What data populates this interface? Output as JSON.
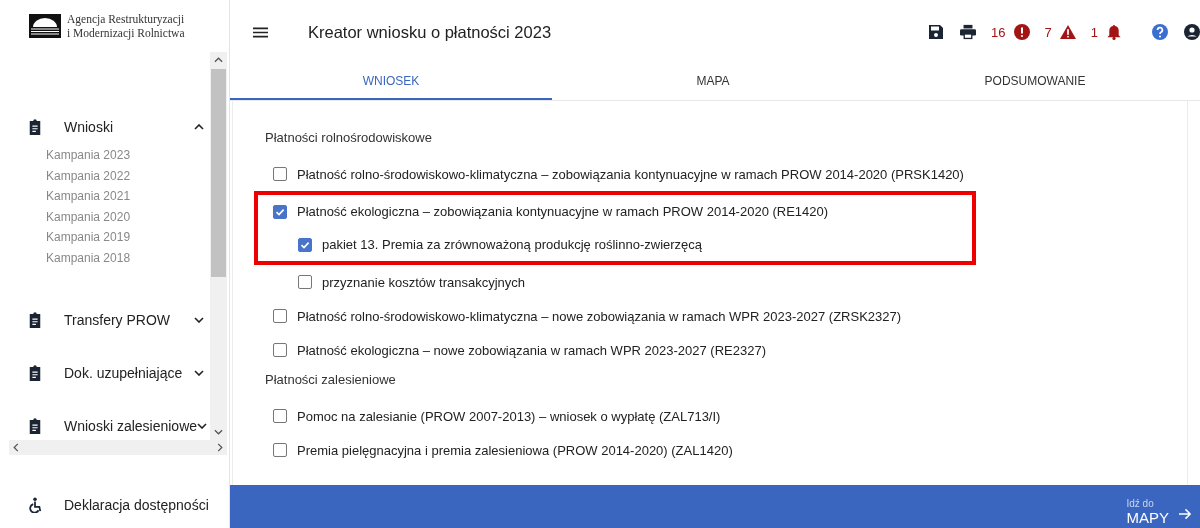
{
  "logo": {
    "line_1": "Agencja Restrukturyzacji",
    "line_2": "i Modernizacji Rolnictwa"
  },
  "sidebar": {
    "items": [
      {
        "label": "Wnioski",
        "expanded": true,
        "children": [
          {
            "label": "Kampania 2023"
          },
          {
            "label": "Kampania 2022"
          },
          {
            "label": "Kampania 2021"
          },
          {
            "label": "Kampania 2020"
          },
          {
            "label": "Kampania 2019"
          },
          {
            "label": "Kampania 2018"
          }
        ]
      },
      {
        "label": "Transfery PROW",
        "expanded": false
      },
      {
        "label": "Dok. uzupełniające",
        "expanded": false
      },
      {
        "label": "Wnioski zalesieniowe",
        "expanded": false
      }
    ],
    "footer_link": "Deklaracja dostępności"
  },
  "header": {
    "title": "Kreator wniosku o płatności 2023",
    "counters": [
      {
        "kind": "error",
        "count": "16"
      },
      {
        "kind": "warning",
        "count": "7"
      },
      {
        "kind": "notification",
        "count": "1"
      }
    ]
  },
  "tabs": [
    {
      "label": "WNIOSEK",
      "selected": true
    },
    {
      "label": "MAPA",
      "selected": false
    },
    {
      "label": "PODSUMOWANIE",
      "selected": false
    }
  ],
  "sections": [
    {
      "title": "Płatności rolnośrodowiskowe",
      "items": [
        {
          "label": "Płatność rolno-środowiskowo-klimatyczna – zobowiązania kontynuacyjne w ramach PROW 2014-2020 (PRSK1420)",
          "checked": false,
          "highlighted": false
        },
        {
          "label": "Płatność ekologiczna – zobowiązania kontynuacyjne w ramach PROW 2014-2020 (RE1420)",
          "checked": true,
          "highlighted": true,
          "children": [
            {
              "label": "pakiet 13. Premia za zrównoważoną produkcję roślinno-zwierzęcą",
              "checked": true,
              "highlighted": true
            },
            {
              "label": "przyznanie kosztów transakcyjnych",
              "checked": false,
              "highlighted": false
            }
          ]
        },
        {
          "label": "Płatność rolno-środowiskowo-klimatyczna – nowe zobowiązania w ramach WPR 2023-2027 (ZRSK2327)",
          "checked": false,
          "highlighted": false
        },
        {
          "label": "Płatność ekologiczna – nowe zobowiązania w ramach WPR 2023-2027 (RE2327)",
          "checked": false,
          "highlighted": false
        }
      ]
    },
    {
      "title": "Płatności zalesieniowe",
      "items": [
        {
          "label": "Pomoc na zalesianie (PROW 2007-2013) – wniosek o wypłatę (ZAL713/I)",
          "checked": false,
          "highlighted": false
        },
        {
          "label": "Premia pielęgnacyjna i premia zalesieniowa (PROW 2014-2020) (ZAL1420)",
          "checked": false,
          "highlighted": false
        }
      ]
    }
  ],
  "next_bar": {
    "caption": "Idź do",
    "target": "MAPY"
  }
}
